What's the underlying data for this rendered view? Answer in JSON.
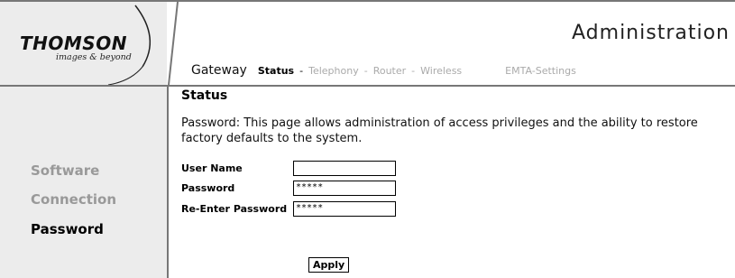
{
  "logo": {
    "brand": "THOMSON",
    "tagline": "images & beyond"
  },
  "header": {
    "title": "Administration"
  },
  "nav": {
    "gateway": "Gateway",
    "items": [
      {
        "label": "Status",
        "active": true
      },
      {
        "label": "Telephony",
        "active": false
      },
      {
        "label": "Router",
        "active": false
      },
      {
        "label": "Wireless",
        "active": false
      },
      {
        "label": "EMTA-Settings",
        "active": false
      }
    ],
    "separator": "-"
  },
  "sidebar": {
    "items": [
      {
        "label": "Software",
        "active": false
      },
      {
        "label": "Connection",
        "active": false
      },
      {
        "label": "Password",
        "active": true
      }
    ]
  },
  "main": {
    "title": "Status",
    "description": "Password: This page allows administration of access privileges and the ability to restore factory defaults to the system.",
    "form": {
      "user_name_label": "User Name",
      "user_name_value": "",
      "password_label": "Password",
      "password_value": "*****",
      "reenter_label": "Re-Enter Password",
      "reenter_value": "*****"
    },
    "apply_label": "Apply"
  }
}
